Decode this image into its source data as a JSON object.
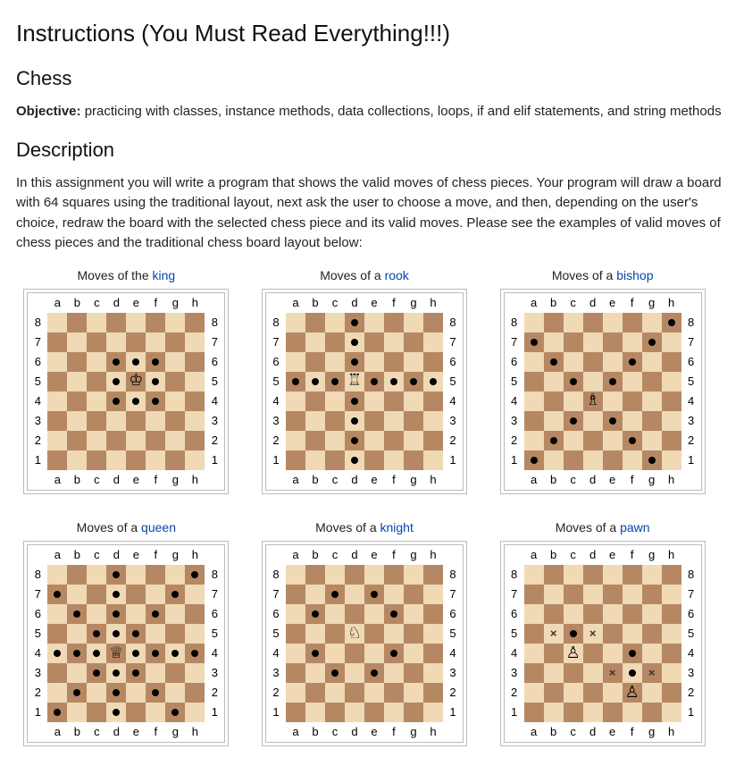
{
  "title": "Instructions (You Must Read Everything!!!)",
  "section1": "Chess",
  "objective_label": "Objective:",
  "objective_text": " practicing with classes, instance methods, data collections, loops, if and elif statements, and string methods",
  "section2": "Description",
  "description_text": "In this assignment you will write a program that shows the valid moves of chess pieces. Your program will draw a board with 64 squares using the traditional layout, next ask the user to choose a move, and then, depending on the user's choice, redraw the board with the selected chess piece and its valid moves. Please see the examples of valid moves of chess pieces and the traditional chess board layout below:",
  "files": [
    "a",
    "b",
    "c",
    "d",
    "e",
    "f",
    "g",
    "h"
  ],
  "ranks": [
    "8",
    "7",
    "6",
    "5",
    "4",
    "3",
    "2",
    "1"
  ],
  "pieces": {
    "king": "♔",
    "queen": "♕",
    "rook": "♖",
    "bishop": "♗",
    "knight": "♘",
    "pawn": "♙"
  },
  "boards": [
    {
      "id": "king",
      "caption_prefix": "Moves of the ",
      "caption_link": "king",
      "piece": "king",
      "piece_square": "e5",
      "moves": [
        "d6",
        "e6",
        "f6",
        "d5",
        "f5",
        "d4",
        "e4",
        "f4"
      ],
      "captures": []
    },
    {
      "id": "rook",
      "caption_prefix": "Moves of a ",
      "caption_link": "rook",
      "piece": "rook",
      "piece_square": "d5",
      "moves": [
        "d8",
        "d7",
        "d6",
        "a5",
        "b5",
        "c5",
        "e5",
        "f5",
        "g5",
        "h5",
        "d4",
        "d3",
        "d2",
        "d1"
      ],
      "captures": []
    },
    {
      "id": "bishop",
      "caption_prefix": "Moves of a ",
      "caption_link": "bishop",
      "piece": "bishop",
      "piece_square": "d4",
      "moves": [
        "h8",
        "a7",
        "g7",
        "b6",
        "f6",
        "c5",
        "e5",
        "c3",
        "e3",
        "b2",
        "f2",
        "a1",
        "g1"
      ],
      "captures": []
    },
    {
      "id": "queen",
      "caption_prefix": "Moves of a ",
      "caption_link": "queen",
      "piece": "queen",
      "piece_square": "d4",
      "moves": [
        "d8",
        "h8",
        "a7",
        "d7",
        "g7",
        "b6",
        "d6",
        "f6",
        "c5",
        "d5",
        "e5",
        "a4",
        "b4",
        "c4",
        "e4",
        "f4",
        "g4",
        "h4",
        "c3",
        "d3",
        "e3",
        "b2",
        "d2",
        "f2",
        "a1",
        "d1",
        "g1"
      ],
      "captures": []
    },
    {
      "id": "knight",
      "caption_prefix": "Moves of a ",
      "caption_link": "knight",
      "piece": "knight",
      "piece_square": "d5",
      "moves": [
        "c7",
        "e7",
        "b6",
        "f6",
        "b4",
        "f4",
        "c3",
        "e3"
      ],
      "captures": []
    },
    {
      "id": "pawn",
      "caption_prefix": "Moves of a ",
      "caption_link": "pawn",
      "piece": "pawn",
      "piece_square": "c4",
      "second_piece_square": "f2",
      "moves": [
        "c5",
        "f4",
        "f3"
      ],
      "captures": [
        "b5",
        "d5",
        "e3",
        "g3"
      ]
    }
  ]
}
